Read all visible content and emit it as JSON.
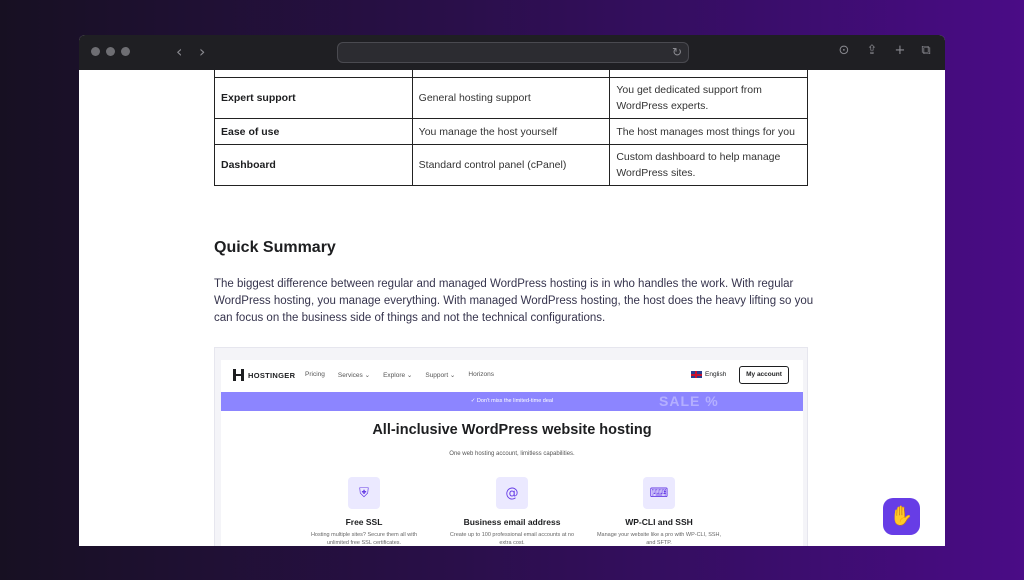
{
  "browser": {
    "back_icon": "chevron-left-icon",
    "forward_icon": "chevron-right-icon",
    "reload_icon": "reload-icon",
    "toolbar_icons": [
      "download-icon",
      "share-icon",
      "new-tab-icon",
      "tabs-overview-icon"
    ],
    "url": ""
  },
  "comparison_table": {
    "rows": [
      {
        "feature": "",
        "regular": "",
        "managed": ""
      },
      {
        "feature": "Expert support",
        "regular": "General hosting support",
        "managed": "You get dedicated support from WordPress experts."
      },
      {
        "feature": "Ease of use",
        "regular": "You manage the host yourself",
        "managed": "The host manages most things for you"
      },
      {
        "feature": "Dashboard",
        "regular": "Standard control panel (cPanel)",
        "managed": "Custom dashboard to help manage WordPress sites."
      }
    ]
  },
  "summary": {
    "title": "Quick Summary",
    "text": "The biggest difference between regular and managed WordPress hosting is in who handles the work. With regular WordPress hosting, you manage everything. With managed WordPress hosting, the host does the heavy lifting so you can focus on the business side of things and not the technical configurations."
  },
  "embedded_screenshot": {
    "brand": "HOSTINGER",
    "nav": [
      "Pricing",
      "Services ⌄",
      "Explore ⌄",
      "Support ⌄",
      "Horizons"
    ],
    "language": "English",
    "account_button": "My account",
    "promo_text": "✓  Don't miss the limited-time deal",
    "promo_sale": "SALE  %",
    "hero_title": "All-inclusive WordPress website hosting",
    "hero_subtitle": "One web hosting account, limitless capabilities.",
    "features": [
      {
        "icon": "shield-icon",
        "title": "Free SSL",
        "desc": "Hosting multiple sites? Secure them all with unlimited free SSL certificates."
      },
      {
        "icon": "email-icon",
        "title": "Business email address",
        "desc": "Create up to 100 professional email accounts at no extra cost."
      },
      {
        "icon": "terminal-icon",
        "title": "WP-CLI and SSH",
        "desc": "Manage your website like a pro with WP-CLI, SSH, and SFTP."
      }
    ]
  },
  "help_button": {
    "icon": "waving-hand-icon"
  },
  "colors": {
    "accent": "#673de6",
    "promo": "#8c85ff",
    "background_left": "#171022",
    "background_right": "#4a0c86"
  }
}
